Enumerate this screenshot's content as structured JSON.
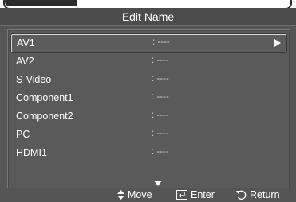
{
  "header": {
    "title": "Edit Name"
  },
  "list": {
    "items": [
      {
        "label": "AV1",
        "value": ": ----",
        "selected": true
      },
      {
        "label": "AV2",
        "value": ": ----"
      },
      {
        "label": "S-Video",
        "value": ": ----"
      },
      {
        "label": "Component1",
        "value": ": ----"
      },
      {
        "label": "Component2",
        "value": ": ----"
      },
      {
        "label": "PC",
        "value": ": ----"
      },
      {
        "label": "HDMI1",
        "value": ": ----"
      }
    ]
  },
  "footer": {
    "move_label": "Move",
    "enter_label": "Enter",
    "return_label": "Return"
  },
  "icons": {
    "selection_arrow": "right-triangle-icon",
    "scroll_down": "down-triangle-icon",
    "move": "up-down-arrows-icon",
    "enter": "enter-icon",
    "return": "return-icon"
  }
}
